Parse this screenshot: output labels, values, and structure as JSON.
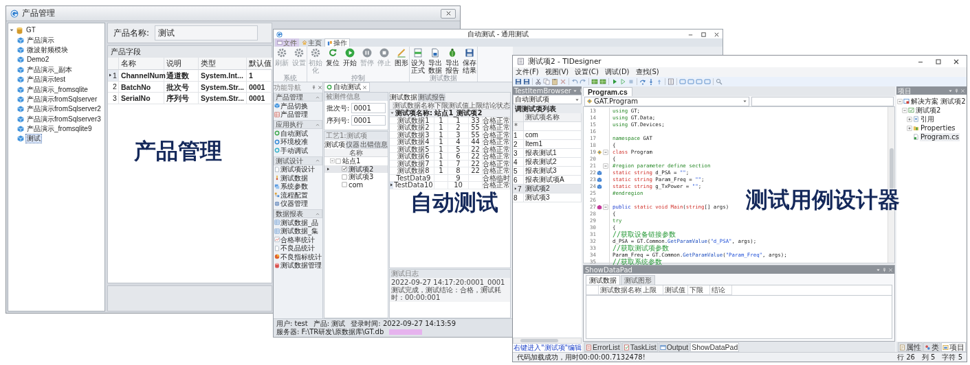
{
  "product_window": {
    "title": "产品管理",
    "tree": {
      "label": "GT",
      "expanded": true,
      "selected": false,
      "children": [
        {
          "label": "产品演示",
          "selected": false
        },
        {
          "label": "微波射频模块",
          "selected": false
        },
        {
          "label": "Demo2",
          "selected": false
        },
        {
          "label": "产品演示_副本",
          "selected": false
        },
        {
          "label": "产品演示test",
          "selected": false
        },
        {
          "label": "产品演示_fromsqlite",
          "selected": false
        },
        {
          "label": "产品演示fromSqlserver",
          "selected": false
        },
        {
          "label": "产品演示fromSqlserver2",
          "selected": false
        },
        {
          "label": "产品演示fromSqlserver3",
          "selected": false
        },
        {
          "label": "产品演示_fromsqlite9",
          "selected": false
        },
        {
          "label": "测试",
          "selected": true
        }
      ]
    },
    "name_field": {
      "label": "产品名称:",
      "value": "测试"
    },
    "fields_title": "产品字段",
    "table": {
      "columns": [
        "名称",
        "说明",
        "类型",
        "默认值"
      ],
      "rows": [
        {
          "number": "1",
          "current": true,
          "cells": [
            "ChannelNum",
            "通道数",
            "System.Int...",
            "1"
          ]
        },
        {
          "number": "2",
          "current": false,
          "cells": [
            "BatchNo",
            "批次号",
            "System.Str...",
            "0001"
          ]
        },
        {
          "number": "3",
          "current": false,
          "cells": [
            "SerialNo",
            "序列号",
            "System.Str...",
            "0001"
          ]
        }
      ]
    }
  },
  "autotest_window": {
    "title": "自动测试 - 通用测试",
    "ribbon_tabs": [
      {
        "label": "文件",
        "selected": false
      },
      {
        "label": "主页",
        "selected": false
      },
      {
        "label": "操作",
        "selected": true
      }
    ],
    "ribbon_groups": [
      {
        "label": "系统",
        "buttons": [
          {
            "label": "刷新",
            "disabled": true
          },
          {
            "label": "设置",
            "disabled": true
          }
        ]
      },
      {
        "label": "控制",
        "buttons": [
          {
            "label": "初始化",
            "disabled": true
          },
          {
            "label": "复位",
            "disabled": false
          },
          {
            "label": "开始",
            "disabled": false
          },
          {
            "label": "暂停",
            "disabled": true
          },
          {
            "label": "停止",
            "disabled": true
          },
          {
            "label": "图形",
            "disabled": false
          }
        ]
      },
      {
        "label": "测试数据",
        "buttons": [
          {
            "label": "设为正式",
            "disabled": false
          },
          {
            "label": "导出数据",
            "disabled": false
          },
          {
            "label": "导出报告",
            "disabled": false
          },
          {
            "label": "保存结果",
            "disabled": false
          }
        ]
      }
    ],
    "nav": {
      "title": "功能导航",
      "sections": [
        {
          "label": "产品管理",
          "expanded": true,
          "items": [
            "产品切换",
            "产品管理"
          ]
        },
        {
          "label": "应用执行",
          "expanded": true,
          "items": [
            "自动测试",
            "环境校准",
            "手动调试"
          ]
        },
        {
          "label": "测试设计",
          "expanded": true,
          "items": [
            "测试项设计",
            "测试数据",
            "系统参数",
            "流程配置",
            "仪器管理"
          ]
        },
        {
          "label": "数据报表",
          "expanded": true,
          "items": [
            "测试数据_品",
            "测试数据_集",
            "合格率统计",
            "不良品统计",
            "不良指标统计",
            "测试数据管理"
          ]
        }
      ]
    },
    "document_tab": "自动测试",
    "dut_panel": {
      "title": "被测件信息",
      "fields": [
        {
          "label": "批次号:",
          "value": "0001"
        },
        {
          "label": "序列号:",
          "value": "0001"
        }
      ]
    },
    "items_panel": {
      "title": "工艺1:测试项",
      "tabs": [
        {
          "label": "测试项",
          "selected": true
        },
        {
          "label": "仪器",
          "selected": false
        },
        {
          "label": "出错信息",
          "selected": false
        }
      ],
      "column": "名称",
      "tree": {
        "label": "站点1",
        "checked": false,
        "expanded": true,
        "selected": false,
        "children": [
          {
            "label": "测试项2",
            "checked": true,
            "selected": true
          },
          {
            "label": "测试项3",
            "checked": false,
            "selected": false
          },
          {
            "label": "com",
            "checked": false,
            "selected": false
          }
        ]
      }
    },
    "data_tabs": [
      {
        "label": "测试数据",
        "selected": true
      },
      {
        "label": "测试报告",
        "selected": false
      }
    ],
    "data_table": {
      "columns": [
        "测试数据名称",
        "下限",
        "测试值",
        "上限",
        "结论",
        "状态"
      ],
      "group": {
        "label": "测试项名称: 站点1_测试项2",
        "expanded": true
      },
      "rows": [
        {
          "current": false,
          "name": "测试数据1",
          "lower": "1",
          "value": "1",
          "upper": "33",
          "result": "合格",
          "status": "正常"
        },
        {
          "current": false,
          "name": "测试数据2",
          "lower": "1",
          "value": "2",
          "upper": "55",
          "result": "合格",
          "status": "正常"
        },
        {
          "current": false,
          "name": "测试数据3",
          "lower": "1",
          "value": "3",
          "upper": "55",
          "result": "合格",
          "status": "正常"
        },
        {
          "current": false,
          "name": "测试数据4",
          "lower": "1",
          "value": "4",
          "upper": "44",
          "result": "合格",
          "status": "正常"
        },
        {
          "current": false,
          "name": "测试数据5",
          "lower": "1",
          "value": "5",
          "upper": "22",
          "result": "合格",
          "status": "正常"
        },
        {
          "current": false,
          "name": "测试数据6",
          "lower": "1",
          "value": "6",
          "upper": "22",
          "result": "合格",
          "status": "正常"
        },
        {
          "current": false,
          "name": "测试数据7",
          "lower": "1",
          "value": "7",
          "upper": "22",
          "result": "合格",
          "status": "正常"
        },
        {
          "current": false,
          "name": "测试数据8",
          "lower": "1",
          "value": "8",
          "upper": "22",
          "result": "合格",
          "status": "正常"
        },
        {
          "current": false,
          "name": "TestData9",
          "value": "9",
          "result": "合格",
          "status": "临时"
        },
        {
          "current": true,
          "name": "TestData10",
          "value": "10",
          "result": "合格",
          "status": "正常"
        }
      ]
    },
    "log": {
      "title": "测试日志",
      "lines": [
        "2022-09-27 14:17:20:0001_0001测试完成，测试结论：合格，测试耗时：00:00:001"
      ]
    },
    "status": [
      "用户: test",
      "产品: 测试",
      "登录时间: 2022-09-27 14:13:59",
      "服务器: F:\\TR研发\\原数据库\\GT.db"
    ]
  },
  "designer_window": {
    "title": "测试项2 - TIDesigner",
    "menu": [
      "文件(F)",
      "视图(V)",
      "设置(C)",
      "调试(D)",
      "查找(S)"
    ],
    "browser": {
      "title": "TestItemBrowser",
      "dropdown": "自动测试项",
      "list_title": "调测试项列表",
      "column": "测试项名称",
      "new_row": "*",
      "rows": [
        {
          "number": "1",
          "name": "com",
          "current": false
        },
        {
          "number": "2",
          "name": "Item1",
          "current": false
        },
        {
          "number": "3",
          "name": "报表测试1",
          "current": false
        },
        {
          "number": "4",
          "name": "报表测试2",
          "current": false
        },
        {
          "number": "5",
          "name": "报表测试3",
          "current": false
        },
        {
          "number": "6",
          "name": "报表测试项A",
          "current": false
        },
        {
          "number": "7",
          "name": "测试项2",
          "current": true
        },
        {
          "number": "8",
          "name": "测试项3",
          "current": false
        }
      ],
      "hint": "右键进入\"测试项\"编辑"
    },
    "editor": {
      "tab": "Program.cs",
      "class_dropdown": "GAT.Program",
      "lines": [
        {
          "number": "13",
          "tokens": [
            {
              "t": "using",
              "kind": "kw"
            },
            {
              "t": " GT;",
              "kind": "p"
            }
          ]
        },
        {
          "number": "14",
          "tokens": [
            {
              "t": "using",
              "kind": "kw"
            },
            {
              "t": " GT.Data;",
              "kind": "p"
            }
          ]
        },
        {
          "number": "15",
          "tokens": [
            {
              "t": "using",
              "kind": "kw"
            },
            {
              "t": " GT.Devices;",
              "kind": "p"
            }
          ]
        },
        {
          "number": "16"
        },
        {
          "number": "17",
          "tokens": [
            {
              "t": "namespace",
              "kind": "kw"
            },
            {
              "t": " GAT",
              "kind": "p"
            }
          ]
        },
        {
          "number": "18",
          "tokens": [
            {
              "t": "{",
              "kind": "p"
            }
          ]
        },
        {
          "number": "19",
          "kind": "class",
          "folded": false,
          "tokens": [
            {
              "t": "   class",
              "kind": "type"
            },
            {
              "t": " Program",
              "kind": "p"
            }
          ]
        },
        {
          "number": "20",
          "tokens": [
            {
              "t": "   {",
              "kind": "p"
            }
          ]
        },
        {
          "number": "21",
          "folded": false,
          "tokens": [
            {
              "t": "      #region parameter define section",
              "kind": "kw"
            }
          ]
        },
        {
          "number": "22",
          "kind": "field",
          "tokens": [
            {
              "t": "      static string",
              "kind": "type"
            },
            {
              "t": " d_PSA = ",
              "kind": "p"
            },
            {
              "t": "\"\"",
              "kind": "str"
            },
            {
              "t": ";",
              "kind": "p"
            }
          ]
        },
        {
          "number": "23",
          "kind": "field",
          "tokens": [
            {
              "t": "      static string",
              "kind": "type"
            },
            {
              "t": " Param_Freq = ",
              "kind": "p"
            },
            {
              "t": "\"\"",
              "kind": "str"
            },
            {
              "t": ";",
              "kind": "p"
            }
          ]
        },
        {
          "number": "24",
          "kind": "field",
          "tokens": [
            {
              "t": "      static string",
              "kind": "type"
            },
            {
              "t": " g_TxPower = ",
              "kind": "p"
            },
            {
              "t": "\"\"",
              "kind": "str"
            },
            {
              "t": ";",
              "kind": "p"
            }
          ]
        },
        {
          "number": "25",
          "tokens": [
            {
              "t": "      #endregion",
              "kind": "kw"
            }
          ]
        },
        {
          "number": "26"
        },
        {
          "number": "27",
          "kind": "method",
          "folded": false,
          "tokens": [
            {
              "t": "      public",
              "kind": "mod"
            },
            {
              "t": " static void Main",
              "kind": "type"
            },
            {
              "t": "(",
              "kind": "p"
            },
            {
              "t": "string",
              "kind": "type"
            },
            {
              "t": "[] args)",
              "kind": "p"
            }
          ]
        },
        {
          "number": "28",
          "tokens": [
            {
              "t": "      {",
              "kind": "p"
            }
          ]
        },
        {
          "number": "29",
          "tokens": [
            {
              "t": "         try",
              "kind": "kw"
            }
          ]
        },
        {
          "number": "30",
          "tokens": [
            {
              "t": "         {",
              "kind": "p"
            }
          ]
        },
        {
          "number": "31",
          "tokens": [
            {
              "t": "            //获取设备链接参数",
              "kind": "comment"
            }
          ]
        },
        {
          "number": "32",
          "tokens": [
            {
              "t": "            d_PSA = GT.Common.",
              "kind": "p"
            },
            {
              "t": "GetParamValue",
              "kind": "method"
            },
            {
              "t": "(",
              "kind": "p"
            },
            {
              "t": "\"d_PSA\"",
              "kind": "str"
            },
            {
              "t": ", args);",
              "kind": "p"
            }
          ]
        },
        {
          "number": "33",
          "tokens": [
            {
              "t": "            //获取测试项参数",
              "kind": "comment"
            }
          ]
        },
        {
          "number": "34",
          "tokens": [
            {
              "t": "            Param_Freq = GT.Common.",
              "kind": "p"
            },
            {
              "t": "GetParamValue",
              "kind": "method"
            },
            {
              "t": "(",
              "kind": "p"
            },
            {
              "t": "\"Param_Freq\"",
              "kind": "str"
            },
            {
              "t": ", args);",
              "kind": "p"
            }
          ]
        },
        {
          "number": "35",
          "tokens": [
            {
              "t": "            //获取系统参数",
              "kind": "comment"
            }
          ]
        }
      ]
    },
    "data_pad": {
      "title": "ShowDataPad",
      "tabs": [
        {
          "label": "测试数据",
          "selected": true
        },
        {
          "label": "测试图形",
          "selected": false
        }
      ],
      "columns": [
        "测试数据名称",
        "上限",
        "测试值",
        "下限",
        "结论"
      ]
    },
    "bottom_tabs": [
      {
        "label": "ErrorList",
        "selected": false
      },
      {
        "label": "TaskList",
        "selected": false
      },
      {
        "label": "Output",
        "selected": false
      },
      {
        "label": "ShowDataPad",
        "selected": true
      }
    ],
    "project": {
      "title": "项目",
      "tree": {
        "label": "解决方案 测试项2",
        "kind": "solution",
        "expanded": true,
        "selected": false,
        "children": [
          {
            "label": "测试项2",
            "kind": "project",
            "expanded": true,
            "selected": false,
            "children": [
              {
                "label": "引用",
                "kind": "references",
                "expanded": false,
                "selected": false
              },
              {
                "label": "Properties",
                "kind": "folder",
                "expanded": false,
                "selected": false
              },
              {
                "label": "Program.cs",
                "kind": "file",
                "selected": true
              }
            ]
          }
        ]
      },
      "tabs": [
        {
          "label": "属性",
          "selected": false
        },
        {
          "label": "类",
          "selected": false
        },
        {
          "label": "项目",
          "selected": true
        }
      ]
    },
    "status": {
      "message": "代码加载成功，用时00:00:00.7132478!",
      "position": [
        "行 26",
        "列 5",
        "字符 5"
      ]
    }
  },
  "captions": [
    "产品管理",
    "自动测试",
    "测试用例设计器"
  ]
}
